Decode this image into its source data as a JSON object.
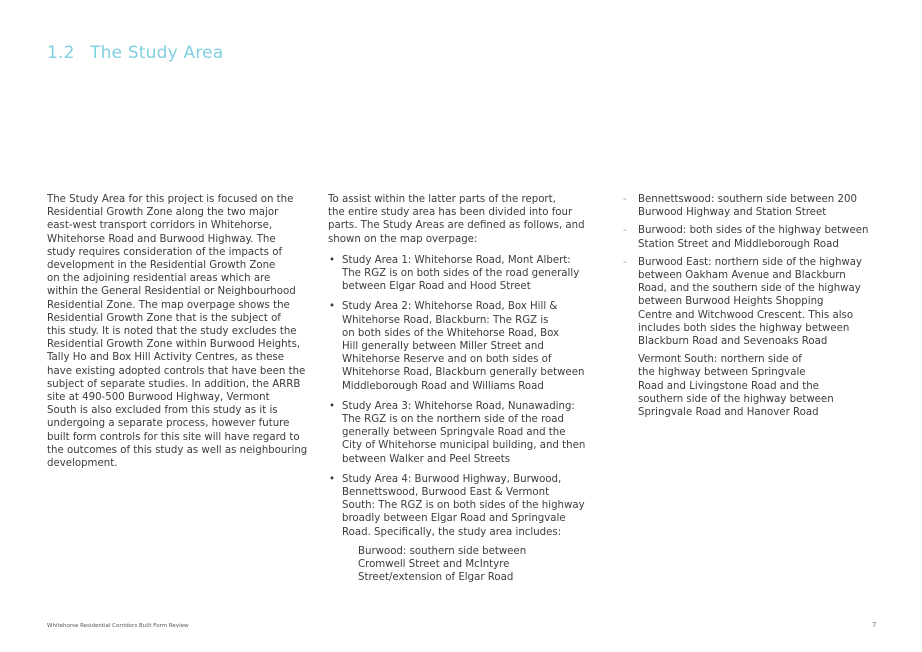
{
  "heading": {
    "number": "1.2",
    "title": "The Study Area"
  },
  "column1": {
    "lines": [
      "The Study Area for this project is focused on the",
      "Residential Growth Zone along the two major",
      "east-west transport corridors in Whitehorse,",
      "Whitehorse Road and Burwood Highway. The",
      "study requires consideration of the impacts of",
      "development in the Residential Growth Zone",
      "on the adjoining residential areas which are",
      "within the General Residential or Neighbourhood",
      "Residential Zone.  The map overpage shows the",
      "Residential Growth Zone that is the subject of",
      "this study. It is noted that the study excludes the",
      "Residential Growth Zone within Burwood Heights,",
      "Tally Ho and Box Hill Activity Centres, as these",
      "have existing adopted controls that have been the",
      "subject of separate studies.  In addition, the ARRB",
      "site at 490-500 Burwood Highway, Vermont",
      "South is also excluded from this study as it is",
      "undergoing a separate process, however future",
      "built form controls for this site will have regard to",
      "the outcomes of this study as well as neighbouring",
      "development."
    ]
  },
  "column2": {
    "intro_lines": [
      "To assist within the latter parts of the report,",
      "the entire study area has been divided into four",
      "parts. The Study Areas are defined as follows, and",
      "shown on the map overpage:"
    ],
    "bullet_symbol": "•",
    "bullets": [
      {
        "lines": [
          "Study Area 1: Whitehorse Road, Mont Albert:",
          "The RGZ is on both sides of the road generally",
          "between Elgar Road and Hood Street"
        ]
      },
      {
        "lines": [
          "Study Area 2: Whitehorse Road, Box Hill &",
          "Whitehorse Road, Blackburn: The RGZ is",
          "on both sides of the Whitehorse Road, Box",
          "Hill generally between Miller Street and",
          "Whitehorse Reserve and on both sides of",
          "Whitehorse Road, Blackburn generally between",
          "Middleborough Road and Williams Road"
        ]
      },
      {
        "lines": [
          "Study Area 3: Whitehorse Road, Nunawading:",
          "The RGZ is on the northern side of the road",
          "generally between Springvale Road and the",
          "City of Whitehorse municipal building, and then",
          "between Walker and Peel Streets"
        ]
      },
      {
        "lines": [
          "Study Area 4: Burwood Highway, Burwood,",
          "Bennettswood, Burwood East & Vermont",
          "South: The RGZ is on both sides of the highway",
          "broadly between Elgar Road and Springvale",
          "Road. Specifically, the study area includes:"
        ],
        "sub_lines": [
          "Burwood: southern side between",
          "Cromwell Street and McIntyre",
          "Street/extension of Elgar Road"
        ]
      }
    ]
  },
  "column3": {
    "dash_symbol": "-",
    "dash_items": [
      {
        "lines": [
          "Bennettswood: southern side between 200",
          "Burwood Highway and Station Street"
        ]
      },
      {
        "lines": [
          "Burwood: both sides of the highway between",
          "Station Street and Middleborough Road"
        ]
      },
      {
        "lines": [
          "Burwood East: northern side of the highway",
          "between Oakham Avenue and Blackburn",
          "Road, and the southern side of the highway",
          "between Burwood Heights Shopping",
          "Centre and Witchwood Crescent. This also",
          "includes both sides the highway between",
          "Blackburn Road and Sevenoaks Road"
        ]
      }
    ],
    "plain_lines": [
      "Vermont South: northern side of",
      "the highway between Springvale",
      "Road and Livingstone Road and the",
      "southern side of the highway between",
      "Springvale Road and Hanover Road"
    ]
  },
  "footer": {
    "document_title": "Whitehorse Residential Corridors Built Form Review",
    "page_number": "7"
  },
  "colors": {
    "heading": "#7fd0e0",
    "body_text": "#3c3c3c"
  }
}
